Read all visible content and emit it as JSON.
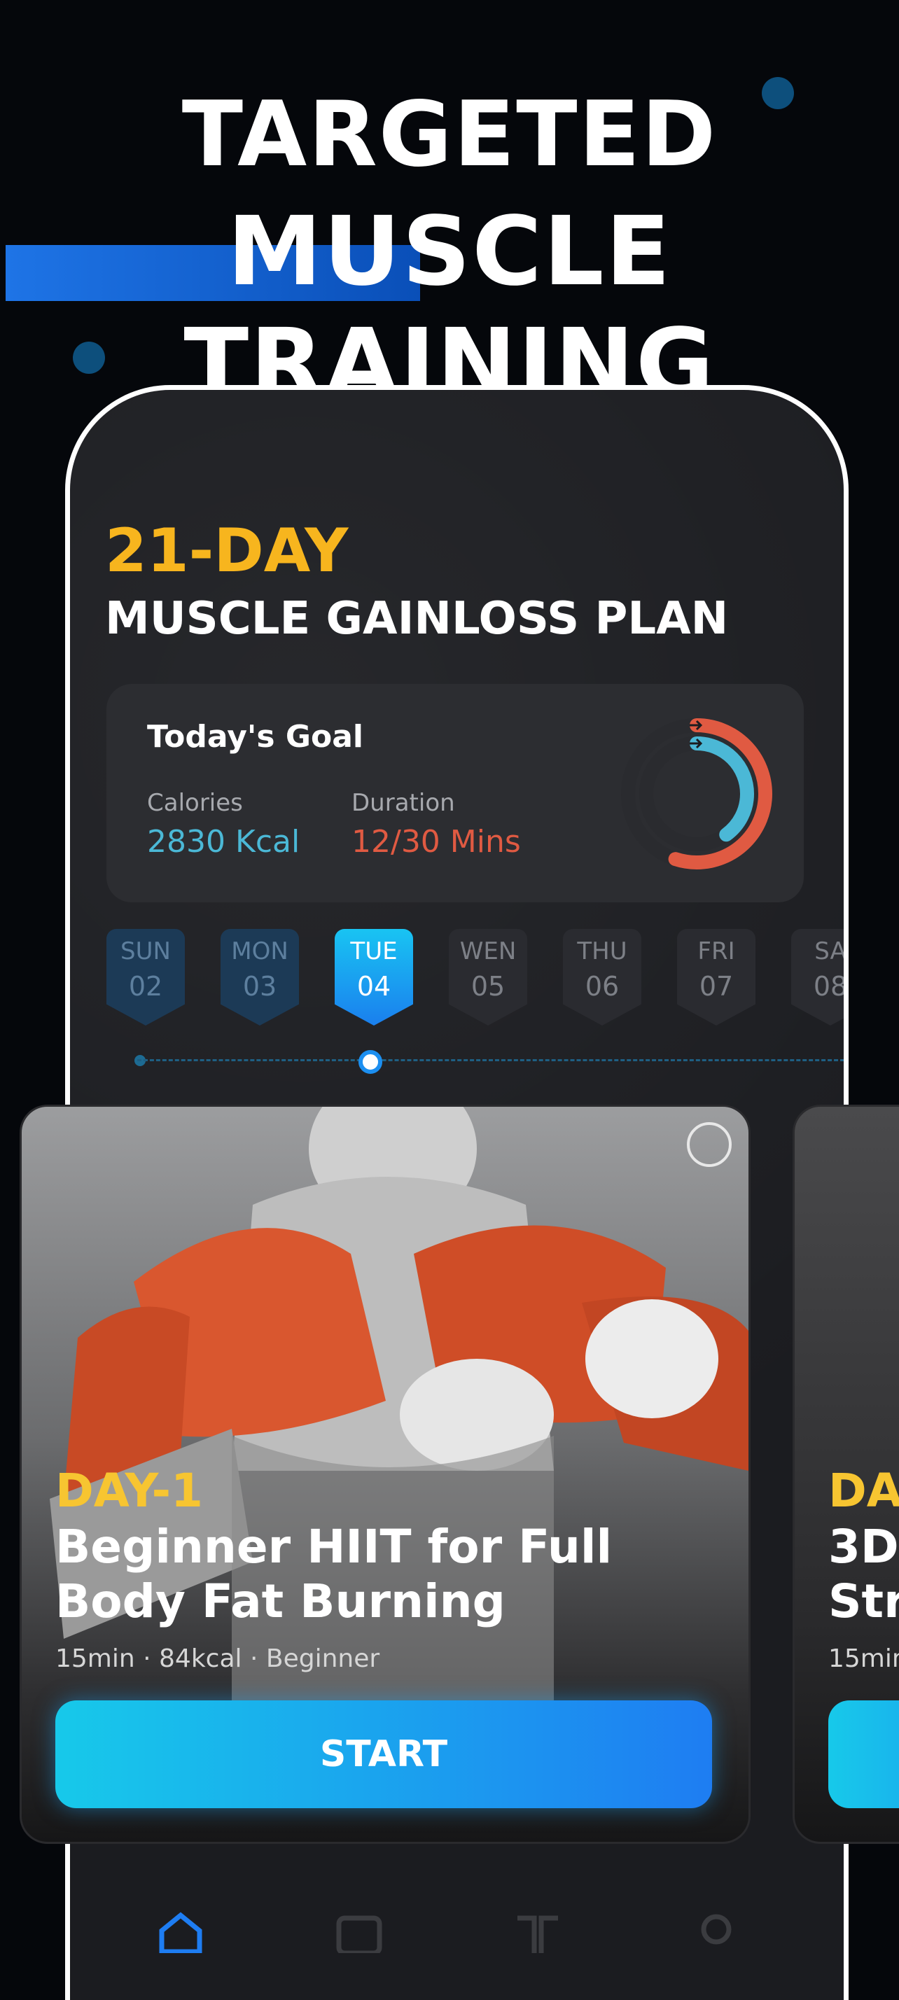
{
  "headline": {
    "line1": "TARGETED",
    "line2_highlight": "MUSCLE",
    "line2_rest": " TRAINING"
  },
  "plan": {
    "day_label": "21-DAY",
    "title": "MUSCLE GAINLOSS PLAN"
  },
  "goal": {
    "title": "Today's Goal",
    "calories_label": "Calories",
    "calories_value": "2830 Kcal",
    "duration_label": "Duration",
    "duration_value": "12/30 Mins",
    "calories_progress": 0.55,
    "duration_progress": 0.4
  },
  "days": [
    {
      "name": "SUN",
      "num": "02",
      "state": "past"
    },
    {
      "name": "MON",
      "num": "03",
      "state": "past"
    },
    {
      "name": "TUE",
      "num": "04",
      "state": "active"
    },
    {
      "name": "WEN",
      "num": "05",
      "state": "future"
    },
    {
      "name": "THU",
      "num": "06",
      "state": "future"
    },
    {
      "name": "FRI",
      "num": "07",
      "state": "future"
    },
    {
      "name": "SA",
      "num": "08",
      "state": "future"
    }
  ],
  "workout_card": {
    "day": "DAY-1",
    "title": "Beginner HIIT for Full Body Fat Burning",
    "meta": "15min · 84kcal · Beginner",
    "button": "START"
  },
  "next_card": {
    "day": "DA",
    "title": "3D\nStr",
    "meta": "15min"
  },
  "colors": {
    "accent_blue": "#1e7df2",
    "accent_cyan": "#17c9ea",
    "yellow": "#f7b51e",
    "calories": "#4bb8d6",
    "duration": "#e05a42"
  },
  "nav_icons": [
    "home-icon",
    "video-icon",
    "book-icon",
    "profile-icon"
  ]
}
